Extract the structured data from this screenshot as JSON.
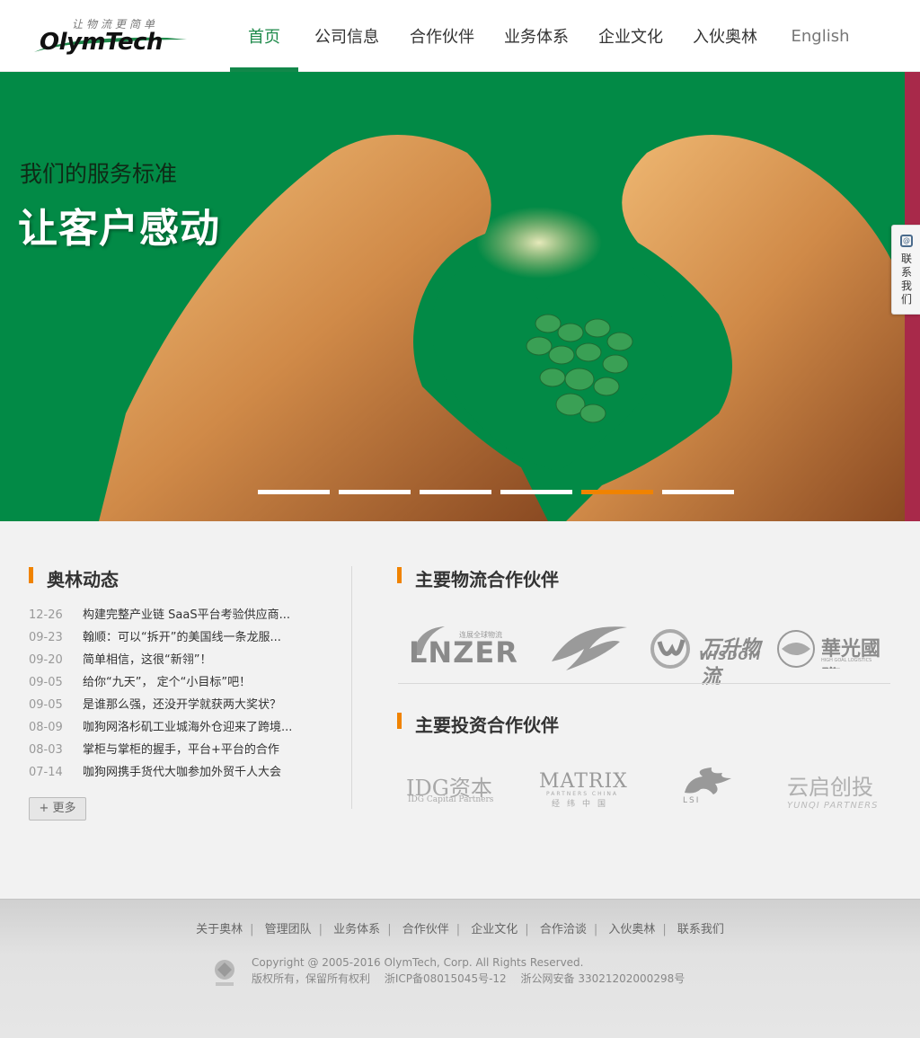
{
  "header": {
    "logo_text": "OlymTech",
    "logo_slogan": "让物流更简单",
    "nav": [
      {
        "label": "首页",
        "active": true
      },
      {
        "label": "公司信息"
      },
      {
        "label": "合作伙伴"
      },
      {
        "label": "业务体系"
      },
      {
        "label": "企业文化"
      },
      {
        "label": "入伙奥林"
      },
      {
        "label": "English"
      }
    ]
  },
  "banner": {
    "subtitle": "我们的服务标准",
    "title": "让客户感动",
    "active_slide": 5,
    "slide_count": 6,
    "colors": {
      "background": "#028a46",
      "indicator_active": "#f08300",
      "indicator": "#ffffff"
    }
  },
  "contact_tab": {
    "label": "联系我们",
    "icon": "at-icon"
  },
  "news": {
    "title": "奥林动态",
    "items": [
      {
        "date": "12-26",
        "title": "构建完整产业链 SaaS平台考验供应商..."
      },
      {
        "date": "09-23",
        "title": "翰顺：可以“拆开”的美国线一条龙服..."
      },
      {
        "date": "09-20",
        "title": "简单相信，这很“新翎”！"
      },
      {
        "date": "09-05",
        "title": "给你“九天”， 定个“小目标”吧！"
      },
      {
        "date": "09-05",
        "title": "是谁那么强，还没开学就获两大奖状？"
      },
      {
        "date": "08-09",
        "title": "咖狗网洛杉矶工业城海外仓迎来了跨境..."
      },
      {
        "date": "08-03",
        "title": "掌柜与掌柜的握手，平台+平台的合作"
      },
      {
        "date": "07-14",
        "title": "咖狗网携手货代大咖参加外贸千人大会"
      }
    ],
    "more_label": "+ 更多"
  },
  "logistics_partners": {
    "title": "主要物流合作伙伴",
    "lnzer": {
      "name": "LNZER",
      "cn": "连展全球物流"
    },
    "wisdom": {
      "cn": "万升物流",
      "en": "WISDOM"
    },
    "hg": {
      "cn": "華光國際",
      "en": "HIGH GOAL LOGISTICS"
    }
  },
  "investment_partners": {
    "title": "主要投资合作伙伴",
    "idg": {
      "main": "IDG资本",
      "sub": "IDG Capital Partners"
    },
    "matrix": {
      "main": "MATRIX",
      "sub1": "PARTNERS CHINA",
      "sub2": "经纬中国"
    },
    "lsi": {
      "text": "LSI"
    },
    "yunqi": {
      "main": "云启创投",
      "sub": "YUNQI PARTNERS"
    }
  },
  "footer": {
    "links": [
      "关于奥林",
      "管理团队",
      "业务体系",
      "合作伙伴",
      "企业文化",
      "合作洽谈",
      "入伙奥林",
      "联系我们"
    ],
    "copyright": "Copyright @ 2005-2016 OlymTech, Corp. All Rights Reserved.",
    "rights": "版权所有，保留所有权利",
    "icp": "浙ICP备08015045号-12",
    "police": "浙公网安备 33021202000298号"
  }
}
